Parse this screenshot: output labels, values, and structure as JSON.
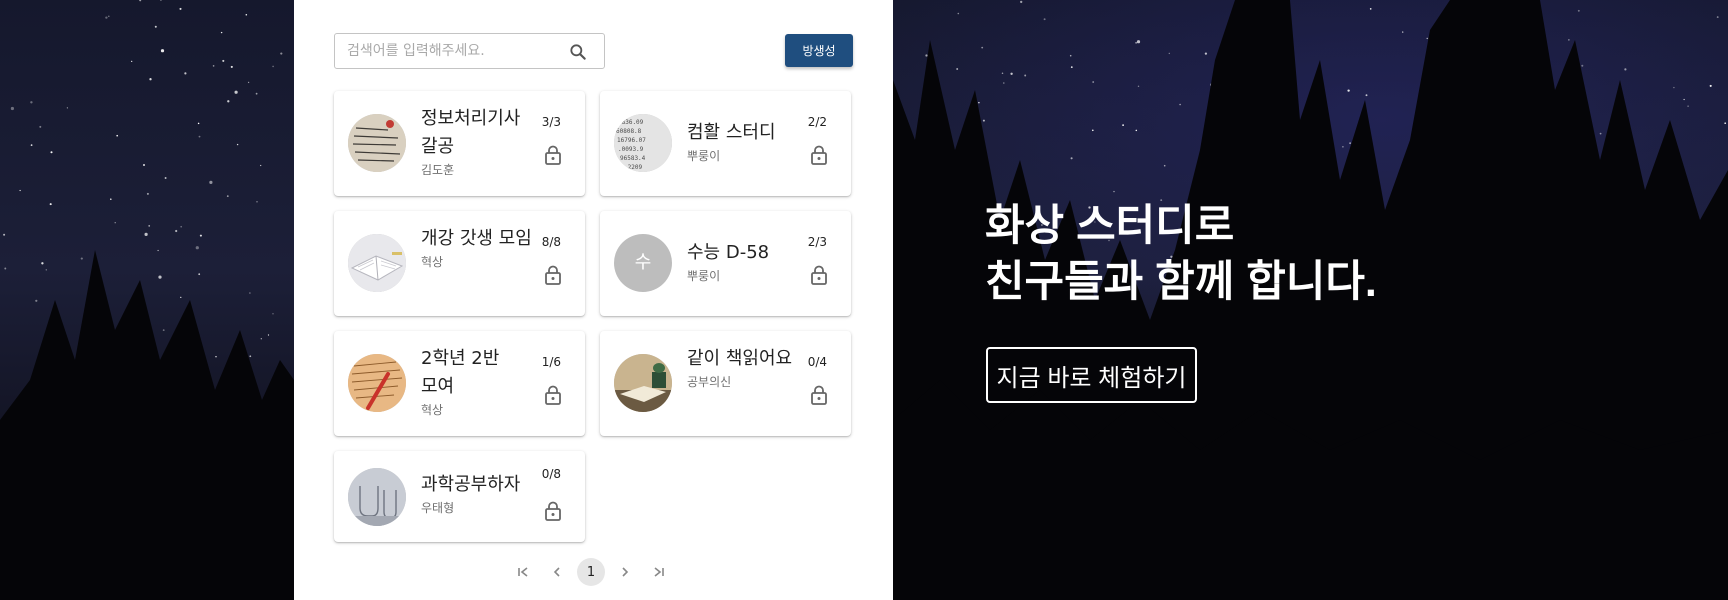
{
  "search": {
    "placeholder": "검색어를 입력해주세요."
  },
  "create_button": {
    "label": "방생성"
  },
  "rooms": [
    {
      "title": "정보처리기사 갈공",
      "owner": "김도훈",
      "count": "3/3"
    },
    {
      "title": "컴활 스터디",
      "owner": "뿌룽이",
      "count": "2/2"
    },
    {
      "title": "개강 갓생 모임",
      "owner": "혁상",
      "count": "8/8"
    },
    {
      "title": "수능 D-58",
      "owner": "뿌룽이",
      "count": "2/3",
      "avatar_letter": "수"
    },
    {
      "title": "2학년 2반 모여",
      "owner": "혁상",
      "count": "1/6"
    },
    {
      "title": "같이 책읽어요",
      "owner": "공부의신",
      "count": "0/4"
    },
    {
      "title": "과학공부하자",
      "owner": "우태형",
      "count": "0/8"
    }
  ],
  "pagination": {
    "current": "1"
  },
  "hero": {
    "line1": "화상 스터디로",
    "line2": "친구들과 함께 합니다.",
    "cta_label": "지금 바로 체험하기"
  },
  "colors": {
    "primary": "#1f4e7f",
    "panel": "#ffffff",
    "night_sky": "#15182d"
  }
}
